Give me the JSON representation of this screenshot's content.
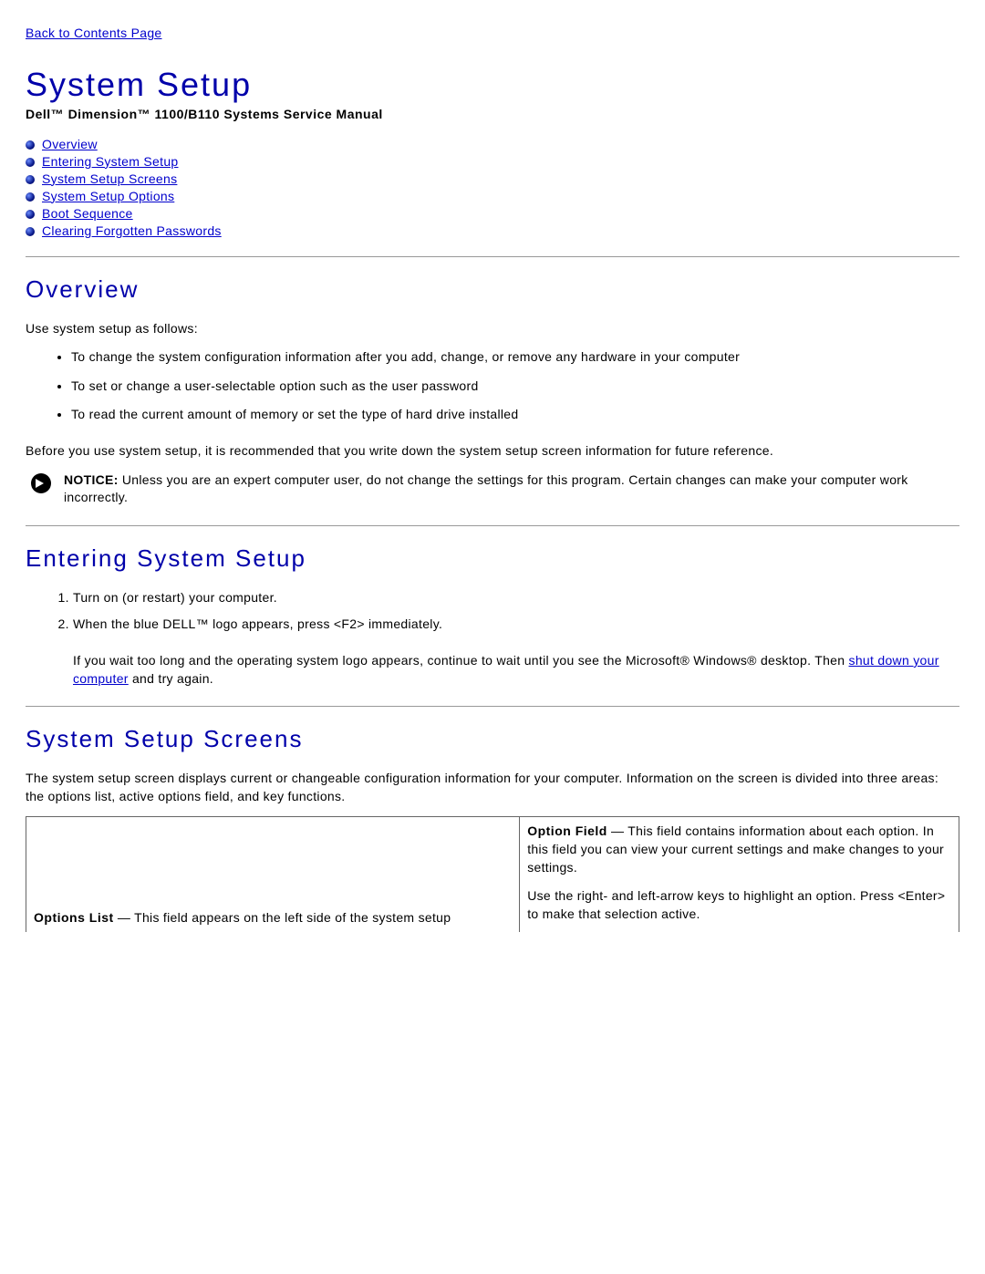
{
  "back_link": "Back to Contents Page",
  "page_title": "System Setup",
  "subtitle": "Dell™ Dimension™ 1100/B110 Systems Service Manual",
  "toc": [
    "Overview",
    "Entering System Setup",
    "System Setup Screens",
    "System Setup Options",
    "Boot Sequence",
    "Clearing Forgotten Passwords"
  ],
  "overview": {
    "heading": "Overview",
    "intro": "Use system setup as follows:",
    "bullets": [
      "To change the system configuration information after you add, change, or remove any hardware in your computer",
      "To set or change a user-selectable option such as the user password",
      "To read the current amount of memory or set the type of hard drive installed"
    ],
    "reco": "Before you use system setup, it is recommended that you write down the system setup screen information for future reference.",
    "notice_label": "NOTICE:",
    "notice_text": " Unless you are an expert computer user, do not change the settings for this program. Certain changes can make your computer work incorrectly."
  },
  "entering": {
    "heading": "Entering System Setup",
    "steps": [
      "Turn on (or restart) your computer.",
      "When the blue DELL™ logo appears, press <F2> immediately."
    ],
    "wait_prefix": "If you wait too long and the operating system logo appears, continue to wait until you see the Microsoft® Windows® desktop. Then ",
    "wait_link": "shut down your computer",
    "wait_suffix": " and try again."
  },
  "screens": {
    "heading": "System Setup Screens",
    "intro": "The system setup screen displays current or changeable configuration information for your computer. Information on the screen is divided into three areas: the options list, active options field, and key functions.",
    "left_title": "Options List",
    "left_text": " — This field appears on the left side of the system setup",
    "right_title": "Option Field",
    "right_text1": " — This field contains information about each option. In this field you can view your current settings and make changes to your settings.",
    "right_text2": "Use the right- and left-arrow keys to highlight an option. Press <Enter> to make that selection active."
  }
}
